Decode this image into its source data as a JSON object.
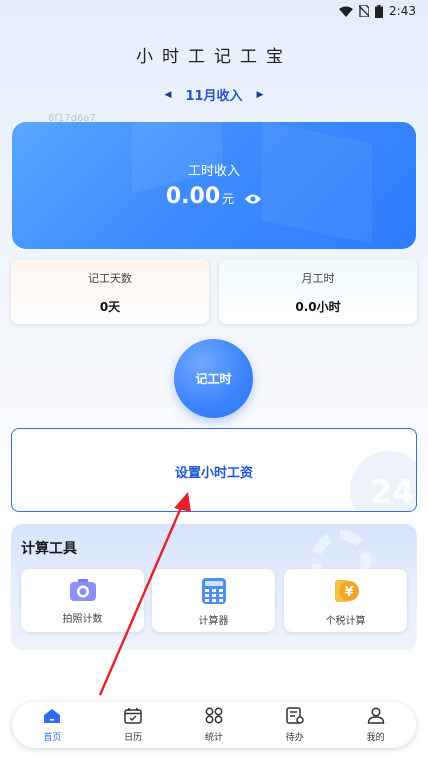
{
  "status_bar": {
    "time": "2:43",
    "icons": [
      "wifi-icon",
      "no-sim-icon",
      "battery-icon"
    ]
  },
  "app": {
    "title": "小时工记工宝",
    "month_label": "11月收入",
    "watermark": "8f17d6a7"
  },
  "income_card": {
    "label": "工时收入",
    "amount": "0.00",
    "unit": "元",
    "icon": "eye-icon"
  },
  "stats": [
    {
      "title": "记工天数",
      "value": "0天"
    },
    {
      "title": "月工时",
      "value": "0.0小时"
    }
  ],
  "record_button": {
    "label": "记工时"
  },
  "wage_card": {
    "label": "设置小时工资",
    "deco_number": "24"
  },
  "tools": {
    "title": "计算工具",
    "items": [
      {
        "label": "拍照计数",
        "icon": "camera-icon"
      },
      {
        "label": "计算器",
        "icon": "calculator-icon"
      },
      {
        "label": "个税计算",
        "icon": "coin-icon"
      }
    ]
  },
  "nav": {
    "items": [
      {
        "label": "首页",
        "icon": "home-icon",
        "active": true
      },
      {
        "label": "日历",
        "icon": "calendar-icon"
      },
      {
        "label": "统计",
        "icon": "grid-icon"
      },
      {
        "label": "待办",
        "icon": "todo-icon"
      },
      {
        "label": "我的",
        "icon": "user-icon"
      }
    ]
  },
  "colors": {
    "primary": "#3e8cff",
    "accent_text": "#1f56d6",
    "annotation_arrow": "#e8202a"
  }
}
